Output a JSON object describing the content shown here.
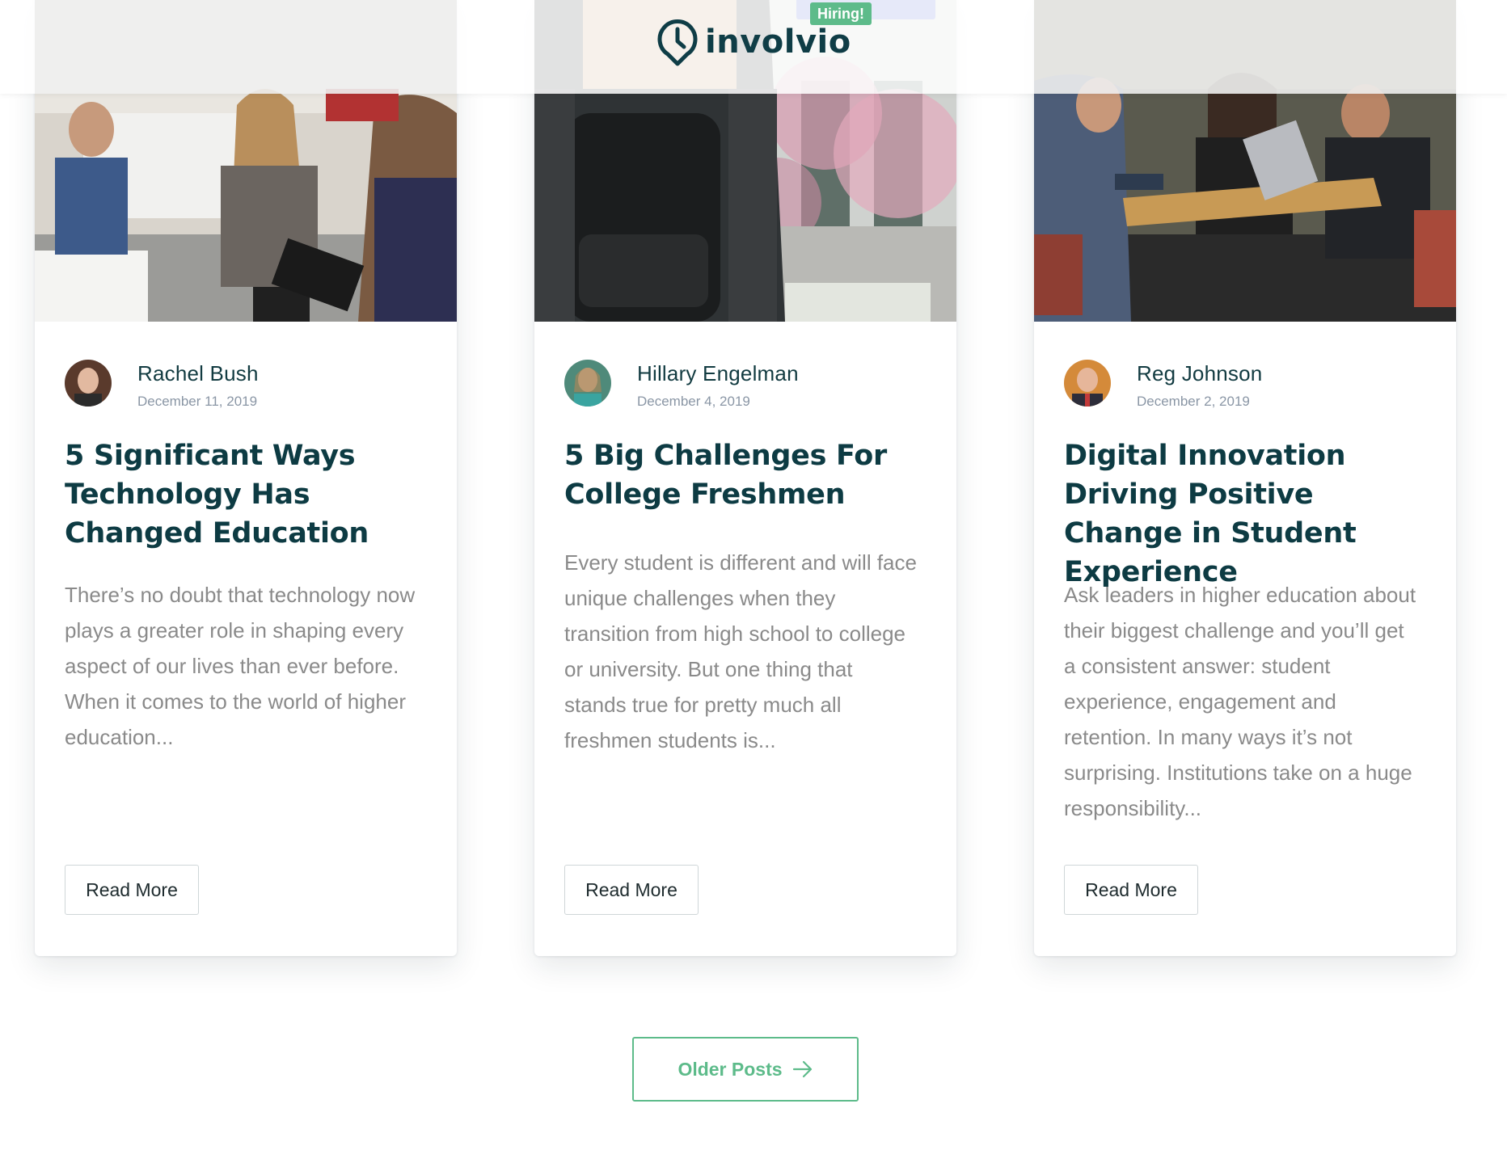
{
  "header": {
    "brand": "involvio",
    "hiring_badge": "Hiring!"
  },
  "posts": [
    {
      "author": "Rachel Bush",
      "date": "December 11, 2019",
      "title": "5 Significant Ways Technology Has Changed Education",
      "excerpt": "There’s no doubt that technology now plays a greater role in shaping every aspect of our lives than ever before. When it comes to the world of higher education...",
      "read_more": "Read More"
    },
    {
      "author": "Hillary Engelman",
      "date": "December 4, 2019",
      "title": "5 Big Challenges For College Freshmen",
      "excerpt": "Every student is different and will face unique challenges when they transition from high school to college or university. But one thing that stands true for pretty much all freshmen students is...",
      "read_more": "Read More"
    },
    {
      "author": "Reg Johnson",
      "date": "December 2, 2019",
      "title": "Digital Innovation Driving Positive Change in Student Experience",
      "excerpt": "Ask leaders in higher education about their biggest challenge and you’ll get a consistent answer: student experience, engagement and retention. In many ways it’s not surprising. Institutions take on a huge responsibility...",
      "read_more": "Read More"
    }
  ],
  "pagination": {
    "older_posts": "Older Posts"
  },
  "colors": {
    "accent": "#5dbb8a",
    "heading": "#0d3b43",
    "body_text": "#8a8a8a"
  },
  "icons": {
    "logo": "clock-pin-icon",
    "older_posts": "arrow-right-icon"
  }
}
